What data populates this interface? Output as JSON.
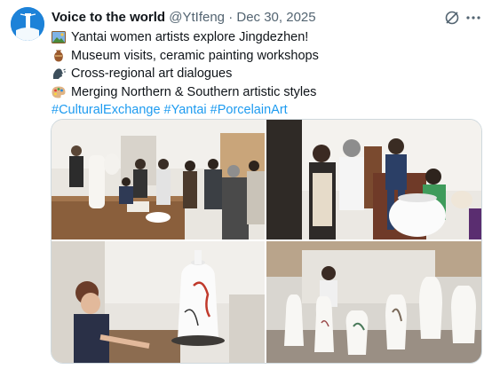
{
  "tweet": {
    "author_name": "Voice to the world",
    "handle": "@YtIfeng",
    "separator": "·",
    "date": "Dec 30, 2025",
    "lines": [
      {
        "icon": "picture-icon",
        "text": "Yantai women artists explore Jingdezhen!"
      },
      {
        "icon": "vase-icon",
        "text": "Museum visits, ceramic painting workshops"
      },
      {
        "icon": "speaking-head-icon",
        "text": "Cross-regional art dialogues"
      },
      {
        "icon": "artist-palette-icon",
        "text": "Merging Northern & Southern artistic styles"
      }
    ],
    "hashtags": [
      "#CulturalExchange",
      "#Yantai",
      "#PorcelainArt"
    ]
  },
  "colors": {
    "link": "#1d9bf0",
    "muted": "#536471",
    "avatar_bg": "#1d82d8",
    "border": "#cfd9de"
  },
  "icons": {
    "grok": "grok-icon",
    "more": "more-options-icon",
    "avatar": "lighthouse-logo"
  }
}
